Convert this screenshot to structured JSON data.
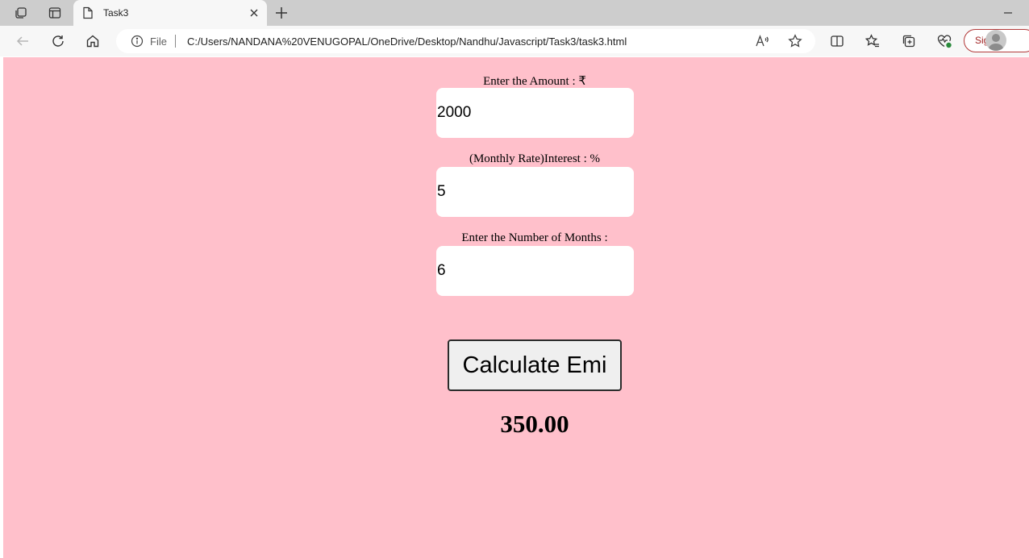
{
  "browser": {
    "tab_title": "Task3",
    "file_label": "File",
    "url": "C:/Users/NANDANA%20VENUGOPAL/OneDrive/Desktop/Nandhu/Javascript/Task3/task3.html",
    "sign_in_label": "Sign in"
  },
  "page": {
    "background_color": "#ffc0cb",
    "amount_label": "Enter the Amount : ₹",
    "amount_value": "2000",
    "interest_label": "(Monthly Rate)Interest : %",
    "interest_value": "5",
    "months_label": "Enter the Number of Months :",
    "months_value": "6",
    "calculate_button_label": "Calculate Emi",
    "result": "350.00"
  }
}
